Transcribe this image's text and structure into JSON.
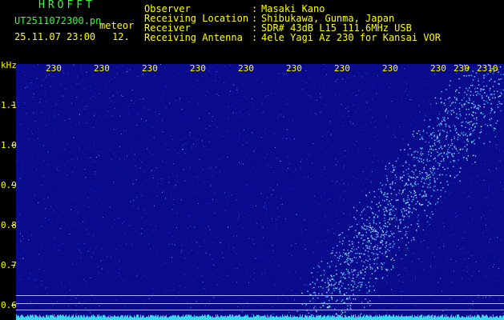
{
  "station": {
    "code": "HROFFT",
    "filename": "UT2511072300.pn",
    "mode": "meteor",
    "datetime": "25.11.07 23:00",
    "count": "12."
  },
  "info": [
    {
      "label": "Observer",
      "sep": ":",
      "value": "Masaki Kano"
    },
    {
      "label": "Receiving Location",
      "sep": ":",
      "value": "Shibukawa, Gunma, Japan"
    },
    {
      "label": "Receiver",
      "sep": ":",
      "value": "SDR# 43dB L15 111.6MHz USB"
    },
    {
      "label": "Receiving Antenna",
      "sep": ":",
      "value": "4ele Yagi Az 230 for Kansai VOR"
    }
  ],
  "y_axis": {
    "unit": "kHz",
    "ticks": [
      "1.1",
      "1.0",
      "0.9",
      "0.8",
      "0.7",
      "0.6"
    ]
  },
  "x_axis": {
    "ticks": [
      "230",
      "230",
      "230",
      "230",
      "230",
      "230",
      "230",
      "230",
      "230",
      "230",
      "2310"
    ]
  },
  "colors": {
    "background": "#000000",
    "waterfall": "#0a0a8c",
    "text_green": "#33ff33",
    "text_yellow": "#ffff00",
    "signal": "#6fd0ff"
  }
}
